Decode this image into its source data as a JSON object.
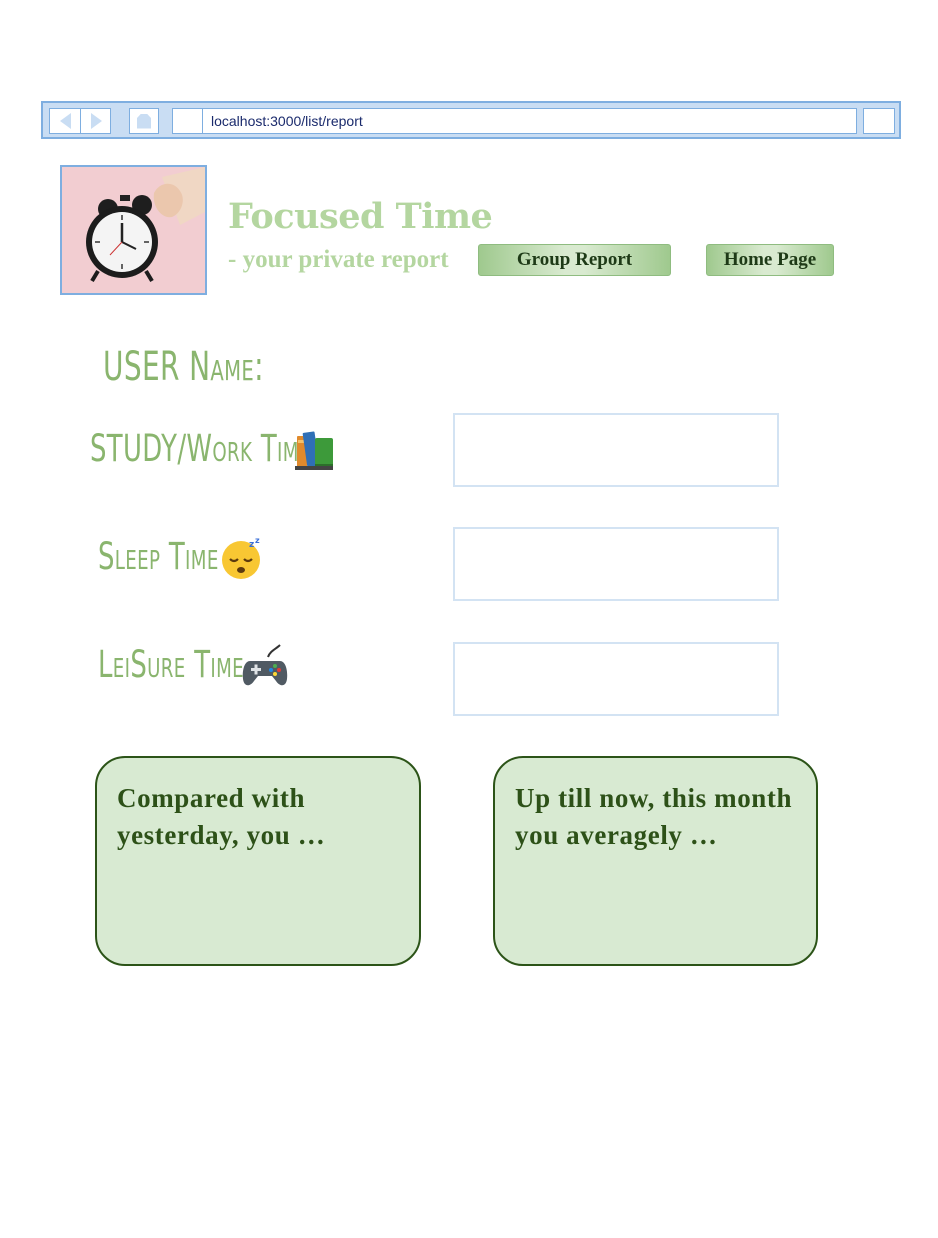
{
  "browser": {
    "url": "localhost:3000/list/report"
  },
  "header": {
    "logo_alt": "alarm clock",
    "title": "Focused Time",
    "subtitle": "- your private report",
    "nav": {
      "group_report": "Group Report",
      "home_page": "Home Page"
    }
  },
  "form": {
    "user_name_label": "USER Name:",
    "fields": [
      {
        "label": "STUDY/Work Time",
        "icon": "books-icon",
        "value": ""
      },
      {
        "label": "Sleep Time",
        "icon": "sleeping-face-icon",
        "value": ""
      },
      {
        "label": "LeiSure Time",
        "icon": "game-controller-icon",
        "value": ""
      }
    ]
  },
  "summary": {
    "compare_yesterday": "Compared with yesterday, you …",
    "month_average": "Up till now, this month you averagely …"
  },
  "colors": {
    "accent_green": "#b4d6a0",
    "label_green": "#8ab56e",
    "card_fill": "#d8ead2",
    "card_border": "#2c5418",
    "browser_blue": "#7eaee0"
  }
}
